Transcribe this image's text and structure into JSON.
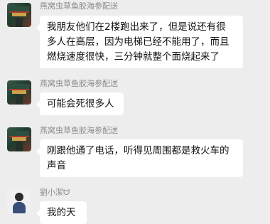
{
  "messages": [
    {
      "sender": "燕窝虫草鱼胶海参配送",
      "avatar_icon": "shop-avatar-icon",
      "lines": [
        "我朋友他们在2楼跑出来了，但是说还有很",
        "多人在高层，因为电梯已经不能用了，而且",
        "燃烧速度很快，三分钟就整个面烧起来了"
      ]
    },
    {
      "sender": "燕窝虫草鱼胶海参配送",
      "avatar_icon": "shop-avatar-icon",
      "lines": [
        "可能会死很多人"
      ]
    },
    {
      "sender": "燕窝虫草鱼胶海参配送",
      "avatar_icon": "shop-avatar-icon",
      "lines": [
        "刚跟他通了电话，听得见周围都是救火车的",
        "声音"
      ]
    },
    {
      "sender": "劉小潔ᗢ",
      "avatar_icon": "person-avatar-icon",
      "lines": [
        "我的天"
      ]
    }
  ],
  "colors": {
    "background": "#ededed",
    "bubble": "#ffffff",
    "sender_name": "#8a8a8a",
    "text": "#111111"
  }
}
